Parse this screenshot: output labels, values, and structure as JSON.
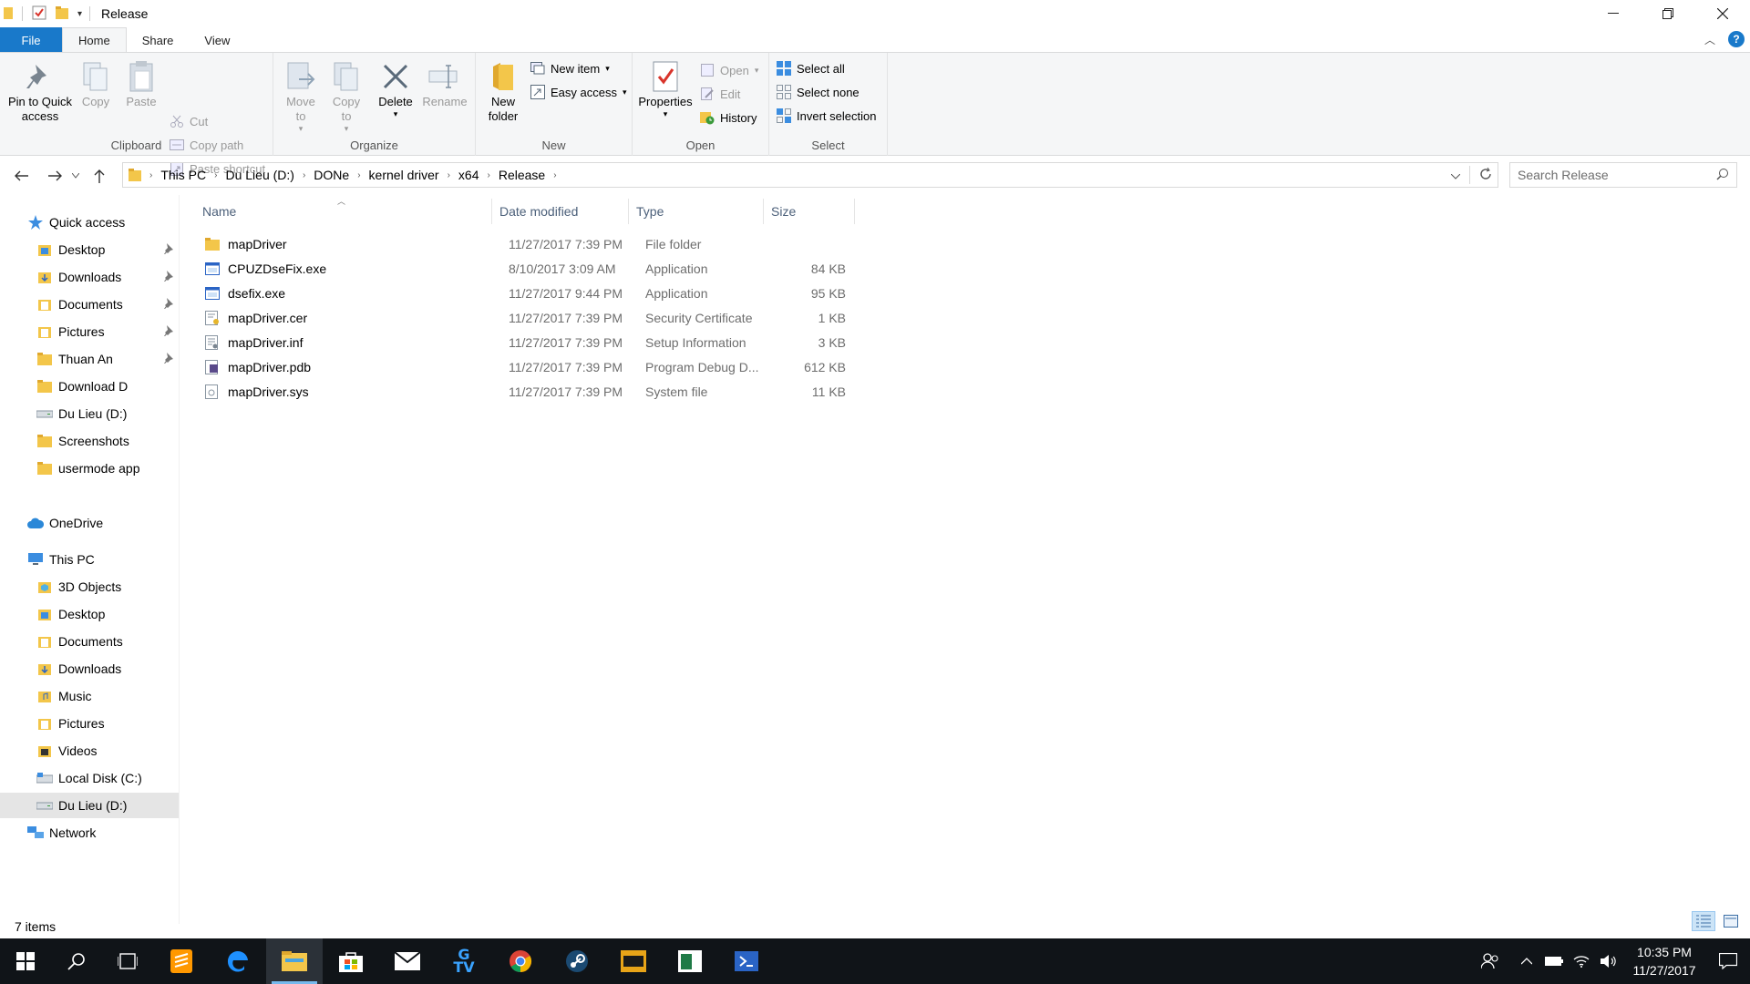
{
  "window": {
    "title": "Release"
  },
  "ribbon_tabs": [
    "File",
    "Home",
    "Share",
    "View"
  ],
  "ribbon": {
    "clipboard": {
      "label": "Clipboard",
      "pin": "Pin to Quick access",
      "copy": "Copy",
      "paste": "Paste",
      "cut": "Cut",
      "copy_path": "Copy path",
      "paste_shortcut": "Paste shortcut"
    },
    "organize": {
      "label": "Organize",
      "move_to": "Move to",
      "copy_to": "Copy to",
      "delete": "Delete",
      "rename": "Rename"
    },
    "new": {
      "label": "New",
      "new_folder": "New folder",
      "new_item": "New item",
      "easy_access": "Easy access"
    },
    "open": {
      "label": "Open",
      "properties": "Properties",
      "open": "Open",
      "edit": "Edit",
      "history": "History"
    },
    "select": {
      "label": "Select",
      "select_all": "Select all",
      "select_none": "Select none",
      "invert_selection": "Invert selection"
    }
  },
  "breadcrumb": [
    "This PC",
    "Du Lieu (D:)",
    "DONe",
    "kernel driver",
    "x64",
    "Release"
  ],
  "search": {
    "placeholder": "Search Release"
  },
  "nav": {
    "quick_access": "Quick access",
    "quick_items": [
      "Desktop",
      "Downloads",
      "Documents",
      "Pictures",
      "Thuan An",
      "Download D",
      "Du Lieu (D:)",
      "Screenshots",
      "usermode app"
    ],
    "onedrive": "OneDrive",
    "this_pc": "This PC",
    "pc_items": [
      "3D Objects",
      "Desktop",
      "Documents",
      "Downloads",
      "Music",
      "Pictures",
      "Videos",
      "Local Disk (C:)",
      "Du Lieu (D:)"
    ],
    "network": "Network"
  },
  "columns": [
    "Name",
    "Date modified",
    "Type",
    "Size"
  ],
  "files": [
    {
      "name": "mapDriver",
      "date": "11/27/2017 7:39 PM",
      "type": "File folder",
      "size": "",
      "icon": "folder-icon"
    },
    {
      "name": "CPUZDseFix.exe",
      "date": "8/10/2017 3:09 AM",
      "type": "Application",
      "size": "84 KB",
      "icon": "app-icon"
    },
    {
      "name": "dsefix.exe",
      "date": "11/27/2017 9:44 PM",
      "type": "Application",
      "size": "95 KB",
      "icon": "app-icon"
    },
    {
      "name": "mapDriver.cer",
      "date": "11/27/2017 7:39 PM",
      "type": "Security Certificate",
      "size": "1 KB",
      "icon": "certificate-icon"
    },
    {
      "name": "mapDriver.inf",
      "date": "11/27/2017 7:39 PM",
      "type": "Setup Information",
      "size": "3 KB",
      "icon": "setup-info-icon"
    },
    {
      "name": "mapDriver.pdb",
      "date": "11/27/2017 7:39 PM",
      "type": "Program Debug D...",
      "size": "612 KB",
      "icon": "pdb-file-icon"
    },
    {
      "name": "mapDriver.sys",
      "date": "11/27/2017 7:39 PM",
      "type": "System file",
      "size": "11 KB",
      "icon": "system-file-icon"
    }
  ],
  "status": {
    "item_count": "7 items"
  },
  "taskbar": {
    "time": "10:35 PM",
    "date": "11/27/2017"
  },
  "colors": {
    "accent": "#1979ca",
    "folder": "#f3c64a",
    "taskbar": "#101418"
  }
}
